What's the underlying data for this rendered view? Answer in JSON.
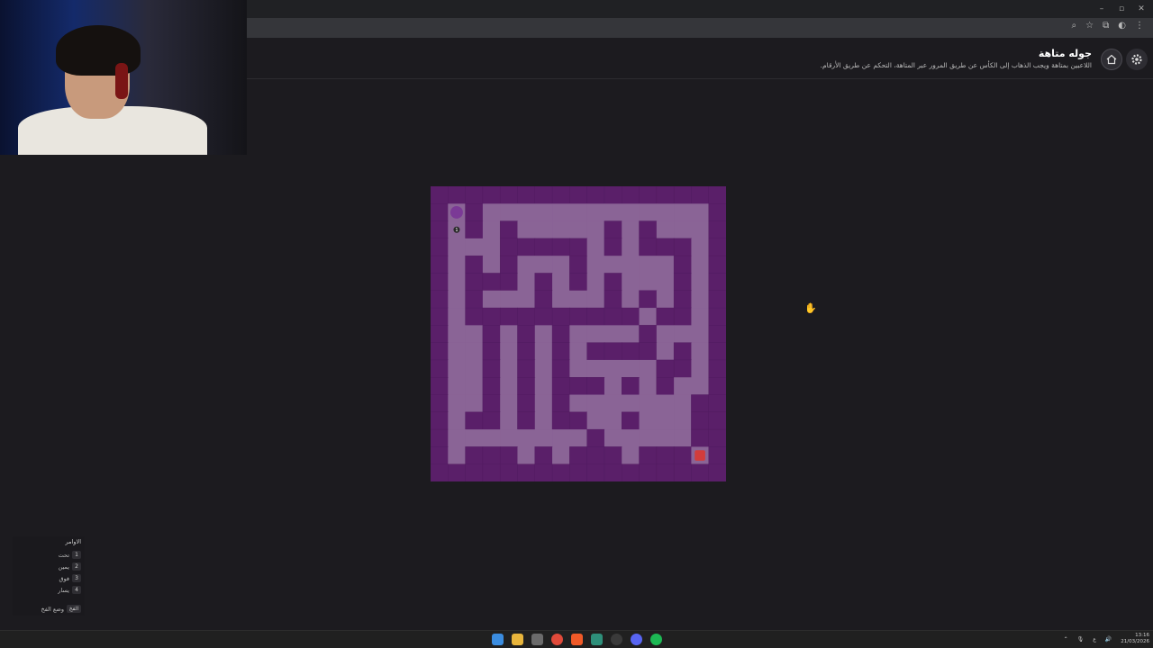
{
  "window": {
    "minimize": "–",
    "maximize": "▫",
    "close": "✕"
  },
  "page": {
    "title": "جوله متاهة",
    "description": "اللاعبين بمتاهة ويجب الذهاب إلى الكأس عن طريق المرور عبر المتاهة، التحكم عن طريق الأرقام."
  },
  "maze": {
    "grid": [
      "#################",
      "#.#.............#",
      "#.#.#.....#.#...#",
      "#...#####.#.###.#",
      "#.#.#...#.....#.#",
      "#.###.#.#.#...#.#",
      "#.#...#...#.#.#.#",
      "#.##########.##.#",
      "#..#.#.#....#...#",
      "#..#.#.#.####.#.#",
      "#..#.#.#.....##.#",
      "#..#.#.###.#.#..#",
      "#..#.#.#.......##",
      "#.##.#.##..#...##",
      "#........#.....##",
      "#.###.#.###.###.#",
      "#################"
    ],
    "player_badge": "1",
    "colors": {
      "wall": "#5a1f69",
      "path": "#8a6496",
      "player": "#7b3a96",
      "goal": "#d23c3c"
    }
  },
  "controls": {
    "title": "الاوامر",
    "commands": [
      {
        "key": "1",
        "label": "تحت"
      },
      {
        "key": "2",
        "label": "يمين"
      },
      {
        "key": "3",
        "label": "فوق"
      },
      {
        "key": "4",
        "label": "يسار"
      }
    ],
    "trap": {
      "key": "الفخ",
      "label": "وضع الفخ"
    }
  },
  "taskbar": {
    "apps": [
      "windows-start-icon",
      "file-explorer-icon",
      "store-icon",
      "chrome-icon",
      "brave-icon",
      "app-icon",
      "obs-icon",
      "discord-icon",
      "spotify-icon"
    ],
    "time": "13:16",
    "date": "21/03/2026",
    "lang": "ع"
  }
}
